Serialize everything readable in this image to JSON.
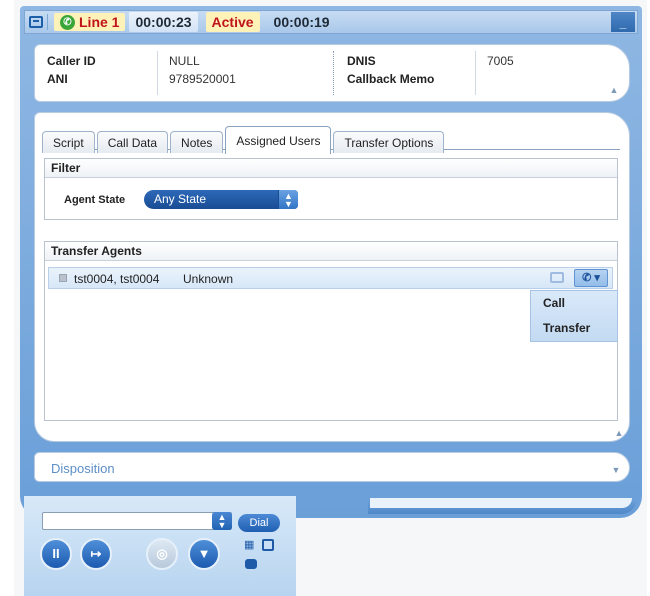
{
  "status_bar": {
    "line_label": "Line",
    "line_number": "1",
    "call_timer": "00:00:23",
    "state": "Active",
    "state_timer": "00:00:19",
    "minimize_label": "_"
  },
  "caller_info": {
    "caller_id_label": "Caller ID",
    "caller_id_value": "NULL",
    "ani_label": "ANI",
    "ani_value": "9789520001",
    "dnis_label": "DNIS",
    "dnis_value": "7005",
    "callback_memo_label": "Callback Memo",
    "callback_memo_value": ""
  },
  "tabs": [
    {
      "label": "Script"
    },
    {
      "label": "Call Data"
    },
    {
      "label": "Notes"
    },
    {
      "label": "Assigned Users",
      "active": true
    },
    {
      "label": "Transfer Options"
    }
  ],
  "filter": {
    "title": "Filter",
    "agent_state_label": "Agent State",
    "agent_state_value": "Any State"
  },
  "transfer_agents": {
    "title": "Transfer Agents",
    "rows": [
      {
        "name": "tst0004, tst0004",
        "state": "Unknown"
      }
    ],
    "menu": [
      "Call",
      "Transfer"
    ]
  },
  "disposition": {
    "label": "Disposition"
  },
  "dialer": {
    "dial_label": "Dial",
    "number_value": ""
  },
  "colors": {
    "accent_blue": "#2d69b8",
    "panel_blue": "#8fb7e3",
    "alert_red": "#c0141a",
    "highlight_yellow": "#fff2b8"
  }
}
